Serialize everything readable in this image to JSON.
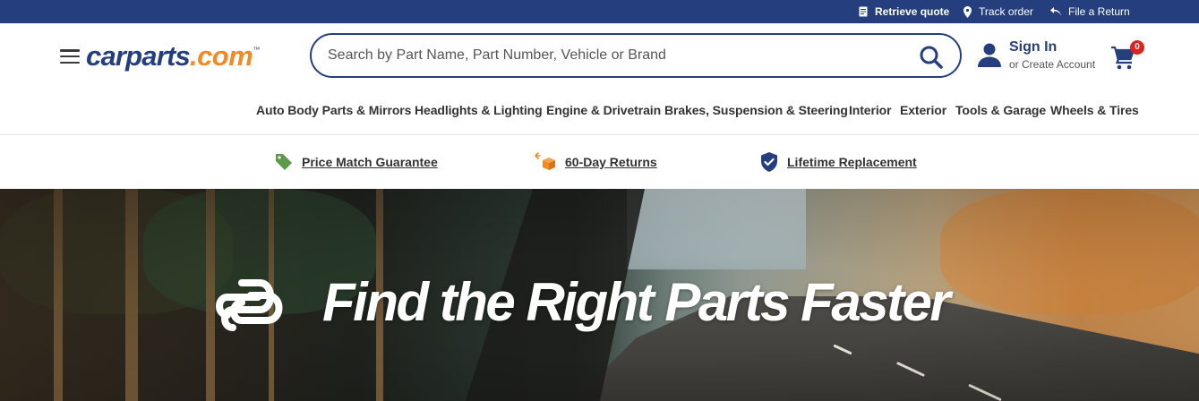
{
  "colors": {
    "brand_navy": "#253e7e",
    "brand_orange": "#f08a24",
    "badge_red": "#dd2222",
    "tag_green": "#5a9a48"
  },
  "utility_bar": {
    "retrieve_quote": "Retrieve quote",
    "track_order": "Track order",
    "file_return": "File a Return"
  },
  "header": {
    "logo_main": "carparts",
    "logo_dot": ".com",
    "logo_tm": "™",
    "search_placeholder": "Search by Part Name, Part Number, Vehicle or Brand",
    "account": {
      "sign_in": "Sign In",
      "create": "or Create Account"
    },
    "cart_count": "0"
  },
  "nav": {
    "items": [
      "Auto Body Parts & Mirrors",
      "Headlights & Lighting",
      "Engine & Drivetrain",
      "Brakes, Suspension & Steering",
      "Interior",
      "Exterior",
      "Tools & Garage",
      "Wheels & Tires"
    ]
  },
  "benefits": {
    "price_match": "Price Match Guarantee",
    "returns": "60-Day Returns",
    "lifetime": "Lifetime Replacement"
  },
  "hero": {
    "headline": "Find the Right Parts Faster"
  }
}
